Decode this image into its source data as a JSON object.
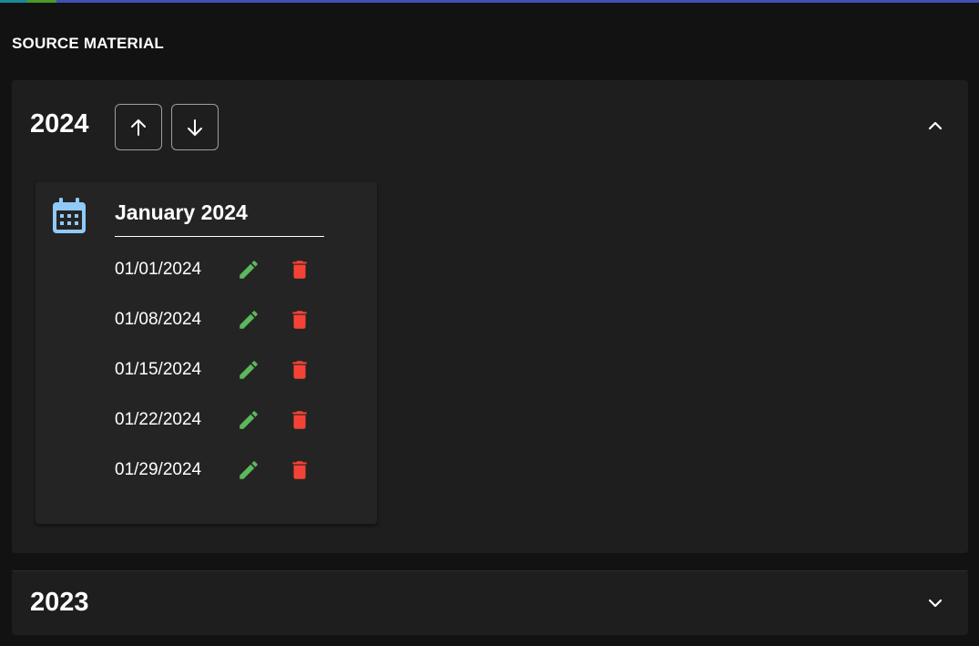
{
  "section_title": "SOURCE MATERIAL",
  "colors": {
    "edit": "#5cb85c",
    "delete": "#f44336",
    "calendar": "#90caf9",
    "accent_bar": "#3f51b5"
  },
  "years": [
    {
      "year": "2024",
      "expanded": true,
      "controls": {
        "move_up_icon": "arrow-up-icon",
        "move_down_icon": "arrow-down-icon",
        "toggle_icon": "chevron-up-icon"
      },
      "months": [
        {
          "title": "January 2024",
          "icon": "calendar-icon",
          "dates": [
            "01/01/2024",
            "01/08/2024",
            "01/15/2024",
            "01/22/2024",
            "01/29/2024"
          ]
        }
      ]
    },
    {
      "year": "2023",
      "expanded": false,
      "controls": {
        "toggle_icon": "chevron-down-icon"
      }
    }
  ]
}
